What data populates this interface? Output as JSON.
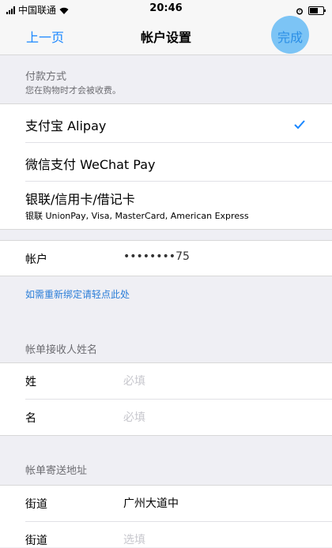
{
  "status_bar": {
    "carrier": "中国联通",
    "time": "20:46"
  },
  "nav": {
    "back_label": "上一页",
    "title": "帐户设置",
    "done_label": "完成"
  },
  "payment": {
    "header": "付款方式",
    "subheader": "您在购物时才会被收费。",
    "options": [
      {
        "label": "支付宝 Alipay",
        "selected": true
      },
      {
        "label": "微信支付 WeChat Pay",
        "selected": false
      },
      {
        "label": "银联/信用卡/借记卡",
        "detail": "银联 UnionPay, Visa, MasterCard, American Express",
        "selected": false
      }
    ]
  },
  "account": {
    "label": "帐户",
    "value": "••••••••75",
    "rebind_link": "如需重新绑定请轻点此处"
  },
  "billing_name": {
    "header": "帐单接收人姓名",
    "last_name_label": "姓",
    "last_name_placeholder": "必填",
    "first_name_label": "名",
    "first_name_placeholder": "必填"
  },
  "billing_address": {
    "header": "帐单寄送地址",
    "street1_label": "街道",
    "street1_value": "广州大道中",
    "street2_label": "街道",
    "street2_placeholder": "选填"
  },
  "colors": {
    "accent": "#1a87ff",
    "check": "#1a87ff",
    "background": "#efeff4"
  }
}
